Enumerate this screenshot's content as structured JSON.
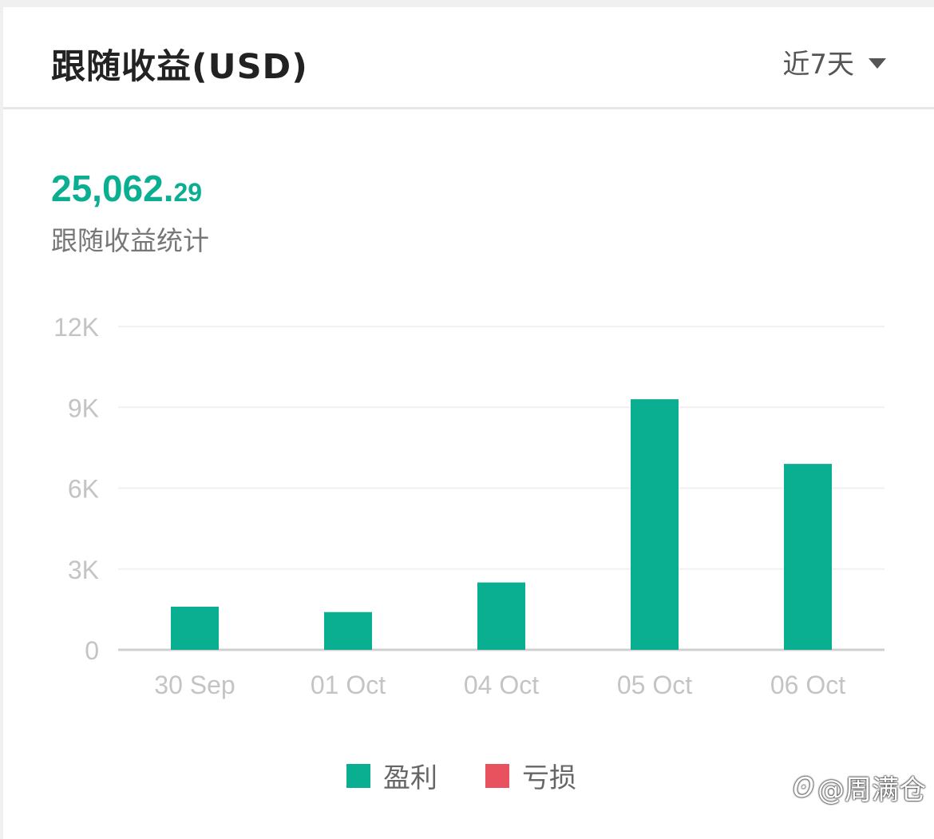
{
  "header": {
    "title": "跟随收益(USD)",
    "range_label": "近7天",
    "range_icon": "caret-down-icon"
  },
  "summary": {
    "total_integer": "25,062.",
    "total_decimal": "29",
    "label": "跟随收益统计"
  },
  "colors": {
    "profit": "#0aae90",
    "loss": "#e8515e"
  },
  "chart_data": {
    "type": "bar",
    "categories": [
      "30 Sep",
      "01 Oct",
      "04 Oct",
      "05 Oct",
      "06 Oct"
    ],
    "series": [
      {
        "name": "盈利",
        "values": [
          1600,
          1400,
          2500,
          9300,
          6900
        ]
      },
      {
        "name": "亏损",
        "values": [
          0,
          0,
          0,
          0,
          0
        ]
      }
    ],
    "ylim": [
      0,
      12000
    ],
    "yticks": [
      0,
      3000,
      6000,
      9000,
      12000
    ],
    "ytick_labels": [
      "0",
      "3K",
      "6K",
      "9K",
      "12K"
    ],
    "grid": true,
    "legend": "bottom"
  },
  "legend": {
    "profit_label": "盈利",
    "loss_label": "亏损"
  },
  "watermark": {
    "icon": "weibo-icon",
    "text": "@周满仓"
  }
}
